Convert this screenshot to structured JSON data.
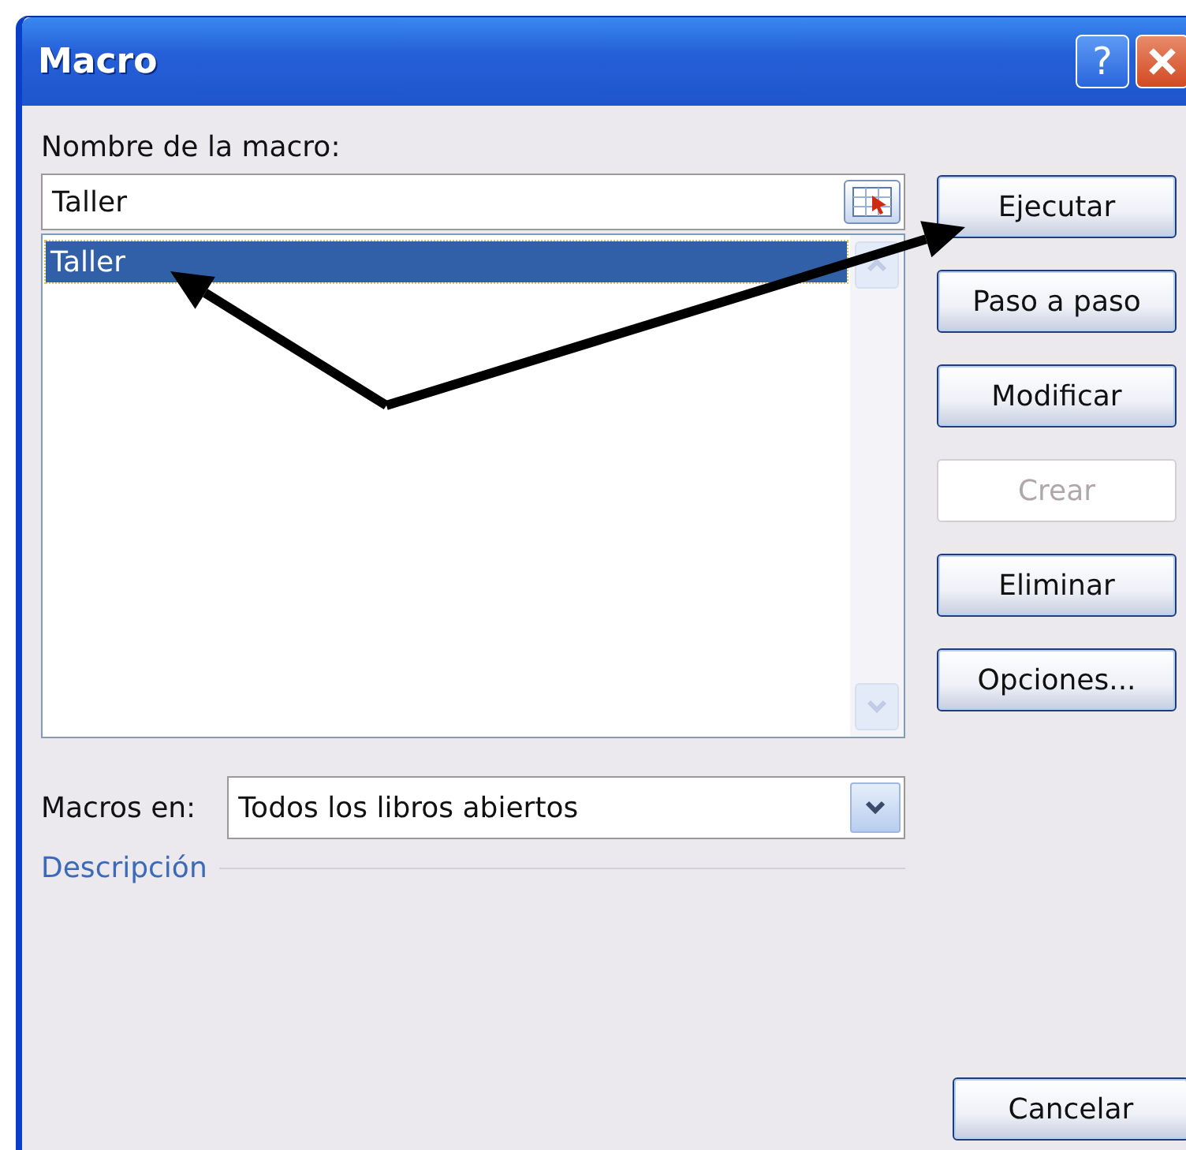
{
  "window": {
    "title": "Macro",
    "title_buttons": [
      "?"
    ]
  },
  "macro_name": {
    "label": "Nombre de la macro:",
    "value": "Taller"
  },
  "macro_list": [
    {
      "name": "Taller",
      "selected": true
    }
  ],
  "buttons": [
    {
      "label": "Ejecutar",
      "disabled": false
    },
    {
      "label": "Paso a paso",
      "disabled": false
    },
    {
      "label": "Modificar",
      "disabled": false
    },
    {
      "label": "Crear",
      "disabled": true
    },
    {
      "label": "Eliminar",
      "disabled": false
    },
    {
      "label": "Opciones...",
      "disabled": false
    }
  ],
  "macros_in": {
    "label": "Macros en:",
    "value": "Todos los libros abiertos"
  },
  "description": {
    "label": "Descripción"
  },
  "cancel_button": {
    "label": "Cancelar"
  }
}
